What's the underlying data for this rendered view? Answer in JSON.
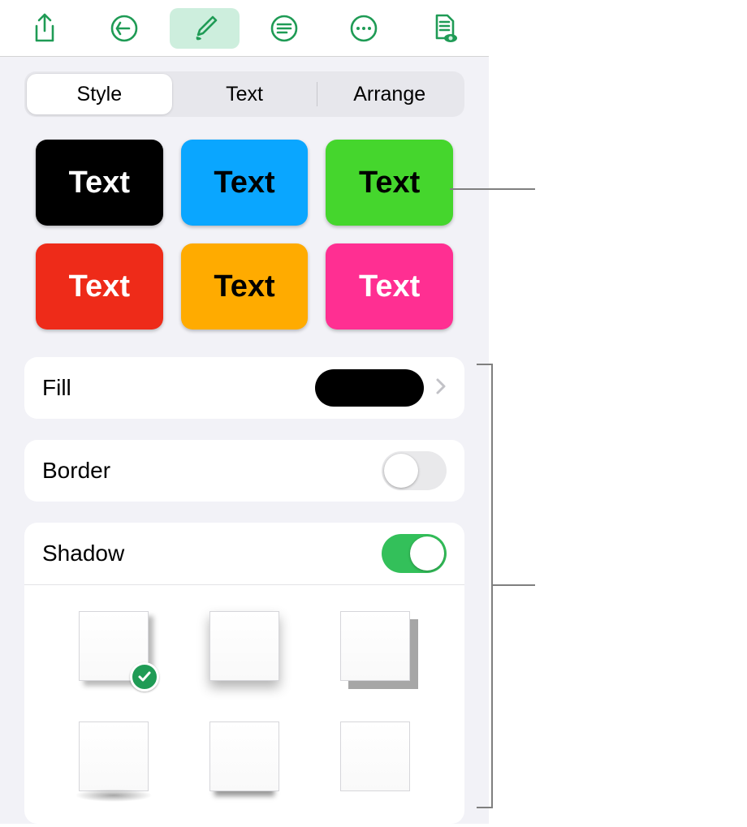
{
  "colors": {
    "accent": "#1f9b55",
    "panel_bg": "#f2f2f7"
  },
  "toolbar_icons": [
    "share",
    "undo",
    "format-brush",
    "insert",
    "more",
    "document-options"
  ],
  "tabs": {
    "items": [
      "Style",
      "Text",
      "Arrange"
    ],
    "active_index": 0
  },
  "presets": [
    {
      "label": "Text",
      "bg": "#000000",
      "fg": "#ffffff"
    },
    {
      "label": "Text",
      "bg": "#0aa6ff",
      "fg": "#000000"
    },
    {
      "label": "Text",
      "bg": "#45d62d",
      "fg": "#000000"
    },
    {
      "label": "Text",
      "bg": "#ee2b19",
      "fg": "#ffffff"
    },
    {
      "label": "Text",
      "bg": "#ffab00",
      "fg": "#000000"
    },
    {
      "label": "Text",
      "bg": "#ff2f92",
      "fg": "#ffffff"
    }
  ],
  "rows": {
    "fill": {
      "label": "Fill",
      "swatch": "#000000"
    },
    "border": {
      "label": "Border",
      "on": false
    },
    "shadow": {
      "label": "Shadow",
      "on": true,
      "selected_index": 0
    }
  }
}
